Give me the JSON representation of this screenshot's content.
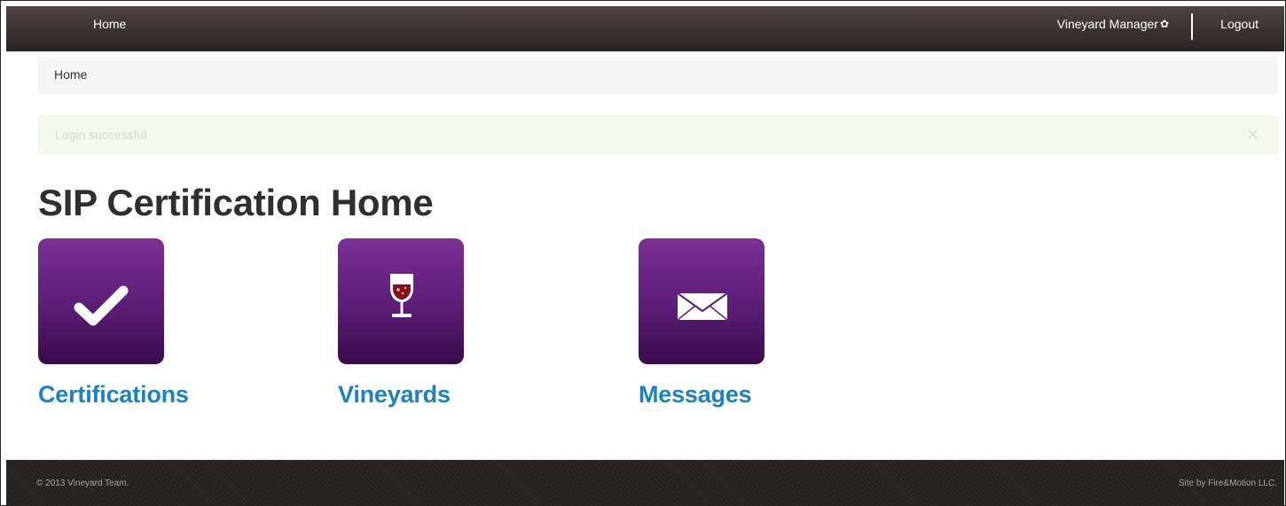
{
  "navbar": {
    "home_label": "Home",
    "user_label": "Vineyard Manager",
    "user_icon": "gear-icon",
    "logout_label": "Logout"
  },
  "breadcrumb": {
    "current": "Home"
  },
  "alert": {
    "message": "Login successful",
    "close_glyph": "×"
  },
  "main": {
    "title": "SIP Certification Home",
    "tiles": [
      {
        "label": "Certifications",
        "icon": "checkmark-icon"
      },
      {
        "label": "Vineyards",
        "icon": "wine-glass-icon"
      },
      {
        "label": "Messages",
        "icon": "envelope-icon"
      }
    ]
  },
  "footer": {
    "copyright": "© 2013 Vineyard Team.",
    "credit": "Site by Fire&Motion LLC."
  },
  "colors": {
    "navbar": "#3a3232",
    "tile_top": "#7c2f95",
    "tile_bottom": "#3a0b4d",
    "link": "#1a82c3",
    "title": "#2f2f2f",
    "wine": "#8b0f16"
  }
}
